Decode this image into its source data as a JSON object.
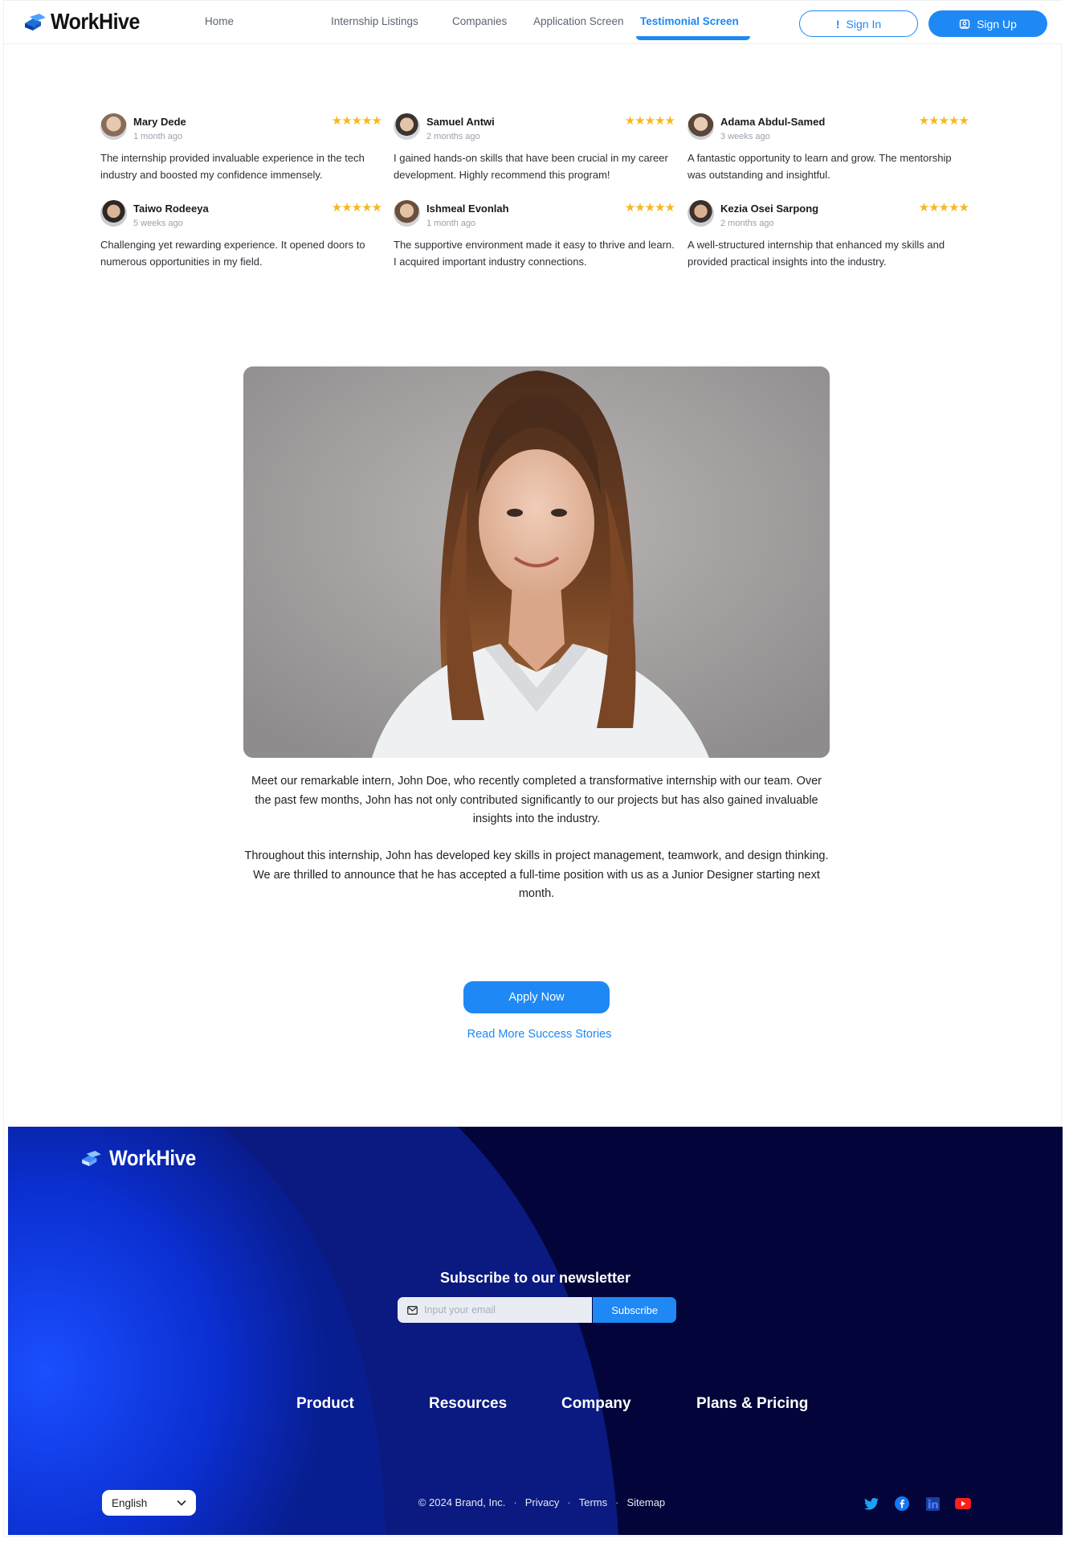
{
  "brand": {
    "name": "WorkHive",
    "accent": "#1e88f5"
  },
  "nav": {
    "links": [
      "Home",
      "Internship Listings",
      "Companies",
      "Application Screen",
      "Testimonial Screen"
    ],
    "active": "Testimonial Screen",
    "signin_label": "Sign In",
    "signup_label": "Sign Up"
  },
  "reviews": [
    {
      "name": "Mary Dede",
      "time": "1 month ago",
      "rating": 5,
      "text": "The internship provided invaluable experience in the tech industry and boosted my confidence immensely."
    },
    {
      "name": "Samuel Antwi",
      "time": "2 months ago",
      "rating": 5,
      "text": "I gained hands-on skills that have been crucial in my career development. Highly recommend this program!"
    },
    {
      "name": "Adama Abdul-Samed",
      "time": "3 weeks ago",
      "rating": 5,
      "text": "A fantastic opportunity to learn and grow. The mentorship was outstanding and insightful."
    },
    {
      "name": "Taiwo Rodeeya",
      "time": "5 weeks ago",
      "rating": 5,
      "text": "Challenging yet rewarding experience. It opened doors to numerous opportunities in my field."
    },
    {
      "name": "Ishmeal Evonlah",
      "time": "1 month ago",
      "rating": 5,
      "text": "The supportive environment made it easy to thrive and learn. I acquired important industry connections."
    },
    {
      "name": "Kezia Osei Sarpong",
      "time": "2 months ago",
      "rating": 5,
      "text": "A well-structured internship that enhanced my skills and provided practical insights into the industry."
    }
  ],
  "story": {
    "paragraph_1": "Meet our remarkable intern, John Doe, who recently completed a transformative internship with our team. Over the past few months, John has not only contributed significantly to our projects but has also gained invaluable insights into the industry.",
    "paragraph_2": "Throughout this internship, John has developed key skills in project management, teamwork, and design thinking. We are thrilled to announce that he has accepted a full-time position with us as a Junior Designer starting next month."
  },
  "cta": {
    "apply_label": "Apply Now",
    "more_label": "Read More Success Stories"
  },
  "footer": {
    "newsletter_title": "Subscribe to our newsletter",
    "email_placeholder": "Input your email",
    "subscribe_label": "Subscribe",
    "columns": [
      "Product",
      "Resources",
      "Company",
      "Plans & Pricing"
    ],
    "language": "English",
    "copyright": "© 2024 Brand, Inc.",
    "legal_links": [
      "Privacy",
      "Terms",
      "Sitemap"
    ],
    "socials": [
      "twitter-icon",
      "facebook-icon",
      "linkedin-icon",
      "youtube-icon"
    ]
  }
}
